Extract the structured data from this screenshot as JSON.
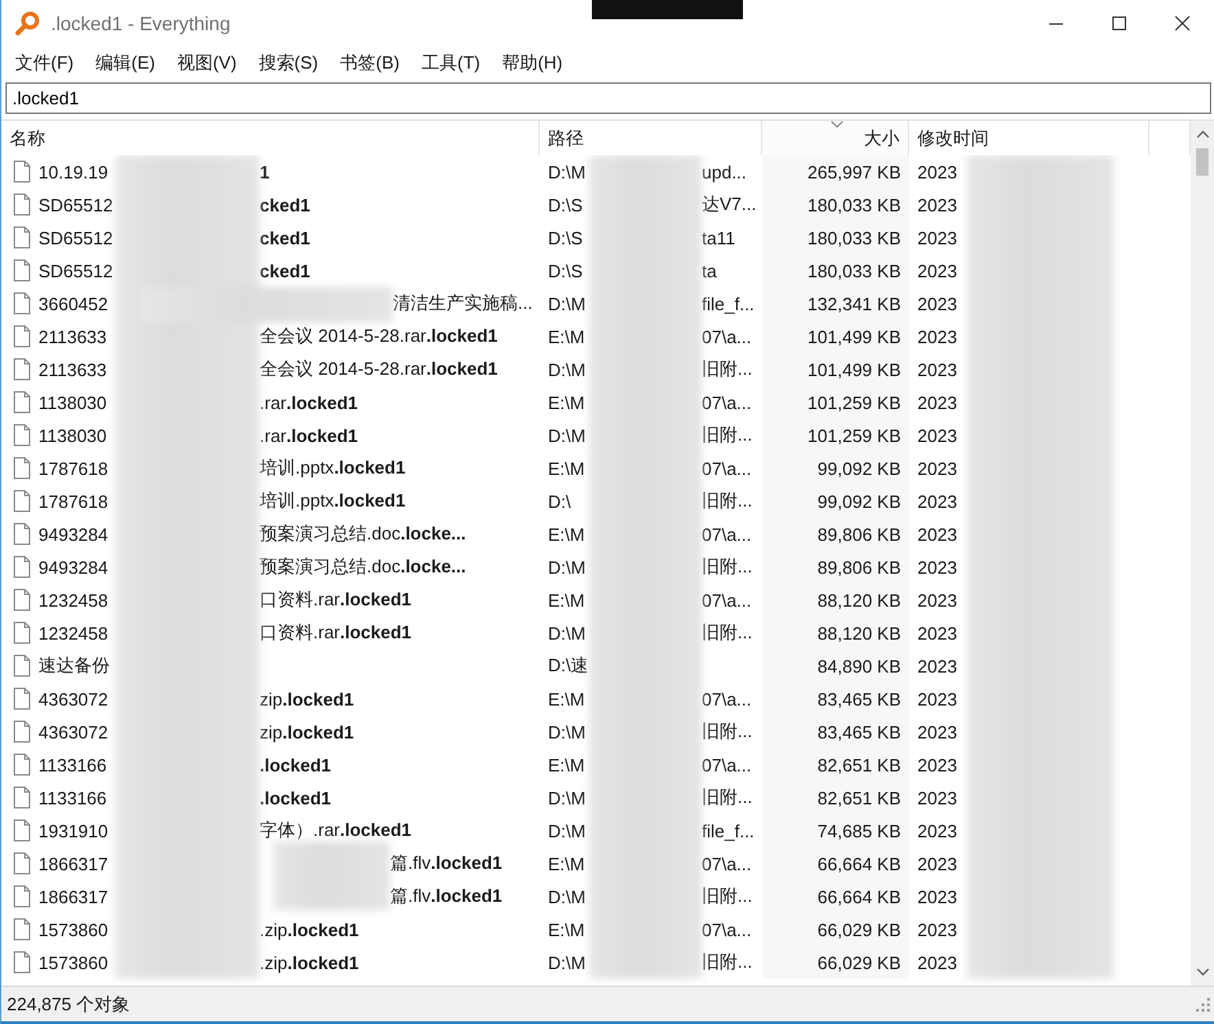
{
  "window": {
    "title": ".locked1 - Everything"
  },
  "menu": [
    "文件(F)",
    "编辑(E)",
    "视图(V)",
    "搜索(S)",
    "书签(B)",
    "工具(T)",
    "帮助(H)"
  ],
  "search": {
    "value": ".locked1"
  },
  "table": {
    "columns": [
      {
        "label": "名称",
        "sorted": false
      },
      {
        "label": "路径",
        "sorted": false
      },
      {
        "label": "大小",
        "sorted": true
      },
      {
        "label": "修改时间",
        "sorted": false
      }
    ],
    "rows": [
      {
        "name_start": "10.19.19",
        "name_end": "**1**",
        "path_start": "D:\\M",
        "path_end": "upd...",
        "size": "265,997 KB",
        "modified": "2023"
      },
      {
        "name_start": "SD65512",
        "name_end": "**cked1**",
        "path_start": "D:\\S",
        "path_end": "达V7...",
        "size": "180,033 KB",
        "modified": "2023"
      },
      {
        "name_start": "SD65512",
        "name_end": "**cked1**",
        "path_start": "D:\\S",
        "path_end": "ta11",
        "size": "180,033 KB",
        "modified": "2023"
      },
      {
        "name_start": "SD65512",
        "name_end": "**cked1**",
        "path_start": "D:\\S",
        "path_end": "ta",
        "size": "180,033 KB",
        "modified": "2023"
      },
      {
        "name_start": "3660452",
        "name_end": "清洁生产实施稿...",
        "path_start": "D:\\M",
        "path_end": "file_f...",
        "size": "132,341 KB",
        "modified": "2023"
      },
      {
        "name_start": "2113633",
        "name_end": "全会议 2014-5-28.rar**.locked1**",
        "path_start": "E:\\M",
        "path_end": "07\\a...",
        "size": "101,499 KB",
        "modified": "2023"
      },
      {
        "name_start": "2113633",
        "name_end": "全会议 2014-5-28.rar**.locked1**",
        "path_start": "D:\\M",
        "path_end": "旧附...",
        "size": "101,499 KB",
        "modified": "2023"
      },
      {
        "name_start": "1138030",
        "name_end": ".rar**.locked1**",
        "path_start": "E:\\M",
        "path_end": "07\\a...",
        "size": "101,259 KB",
        "modified": "2023"
      },
      {
        "name_start": "1138030",
        "name_end": ".rar**.locked1**",
        "path_start": "D:\\M",
        "path_end": "旧附...",
        "size": "101,259 KB",
        "modified": "2023"
      },
      {
        "name_start": "1787618",
        "name_end": "培训.pptx**.locked1**",
        "path_start": "E:\\M",
        "path_end": "07\\a...",
        "size": "99,092 KB",
        "modified": "2023"
      },
      {
        "name_start": "1787618",
        "name_end": "培训.pptx**.locked1**",
        "path_start": "D:\\",
        "path_end": "旧附...",
        "size": "99,092 KB",
        "modified": "2023"
      },
      {
        "name_start": "9493284",
        "name_end": "预案演习总结.doc**.locke...**",
        "path_start": "E:\\M",
        "path_end": "07\\a...",
        "size": "89,806 KB",
        "modified": "2023"
      },
      {
        "name_start": "9493284",
        "name_end": "预案演习总结.doc**.locke...**",
        "path_start": "D:\\M",
        "path_end": "旧附...",
        "size": "89,806 KB",
        "modified": "2023"
      },
      {
        "name_start": "1232458",
        "name_end": "口资料.rar**.locked1**",
        "path_start": "E:\\M",
        "path_end": "07\\a...",
        "size": "88,120 KB",
        "modified": "2023"
      },
      {
        "name_start": "1232458",
        "name_end": "口资料.rar**.locked1**",
        "path_start": "D:\\M",
        "path_end": "旧附...",
        "size": "88,120 KB",
        "modified": "2023"
      },
      {
        "name_start": "速达备份",
        "path_start": "D:\\速",
        "size": "84,890 KB",
        "modified": "2023"
      },
      {
        "name_start": "4363072",
        "name_end": "zip**.locked1**",
        "path_start": "E:\\M",
        "path_end": "07\\a...",
        "size": "83,465 KB",
        "modified": "2023"
      },
      {
        "name_start": "4363072",
        "name_end": "zip**.locked1**",
        "path_start": "D:\\M",
        "path_end": "旧附...",
        "size": "83,465 KB",
        "modified": "2023"
      },
      {
        "name_start": "1133166",
        "name_end": "**.locked1**",
        "path_start": "E:\\M",
        "path_end": "07\\a...",
        "size": "82,651 KB",
        "modified": "2023"
      },
      {
        "name_start": "1133166",
        "name_end": "**.locked1**",
        "path_start": "D:\\M",
        "path_end": "旧附...",
        "size": "82,651 KB",
        "modified": "2023"
      },
      {
        "name_start": "1931910",
        "name_end": "字体）.rar**.locked1**",
        "path_start": "D:\\M",
        "path_end": "file_f...",
        "size": "74,685 KB",
        "modified": "2023"
      },
      {
        "name_start": "1866317",
        "name_end": "篇.flv**.locked1**",
        "path_start": "E:\\M",
        "path_end": "07\\a...",
        "size": "66,664 KB",
        "modified": "2023"
      },
      {
        "name_start": "1866317",
        "name_end": "篇.flv**.locked1**",
        "path_start": "D:\\M",
        "path_end": "旧附...",
        "size": "66,664 KB",
        "modified": "2023"
      },
      {
        "name_start": "1573860",
        "name_end": ".zip**.locked1**",
        "path_start": "E:\\M",
        "path_end": "07\\a...",
        "size": "66,029 KB",
        "modified": "2023"
      },
      {
        "name_start": "1573860",
        "name_end": ".zip**.locked1**",
        "path_start": "D:\\M",
        "path_end": "旧附...",
        "size": "66,029 KB",
        "modified": "2023"
      }
    ]
  },
  "status_bar": {
    "count": "224,875 个对象"
  }
}
